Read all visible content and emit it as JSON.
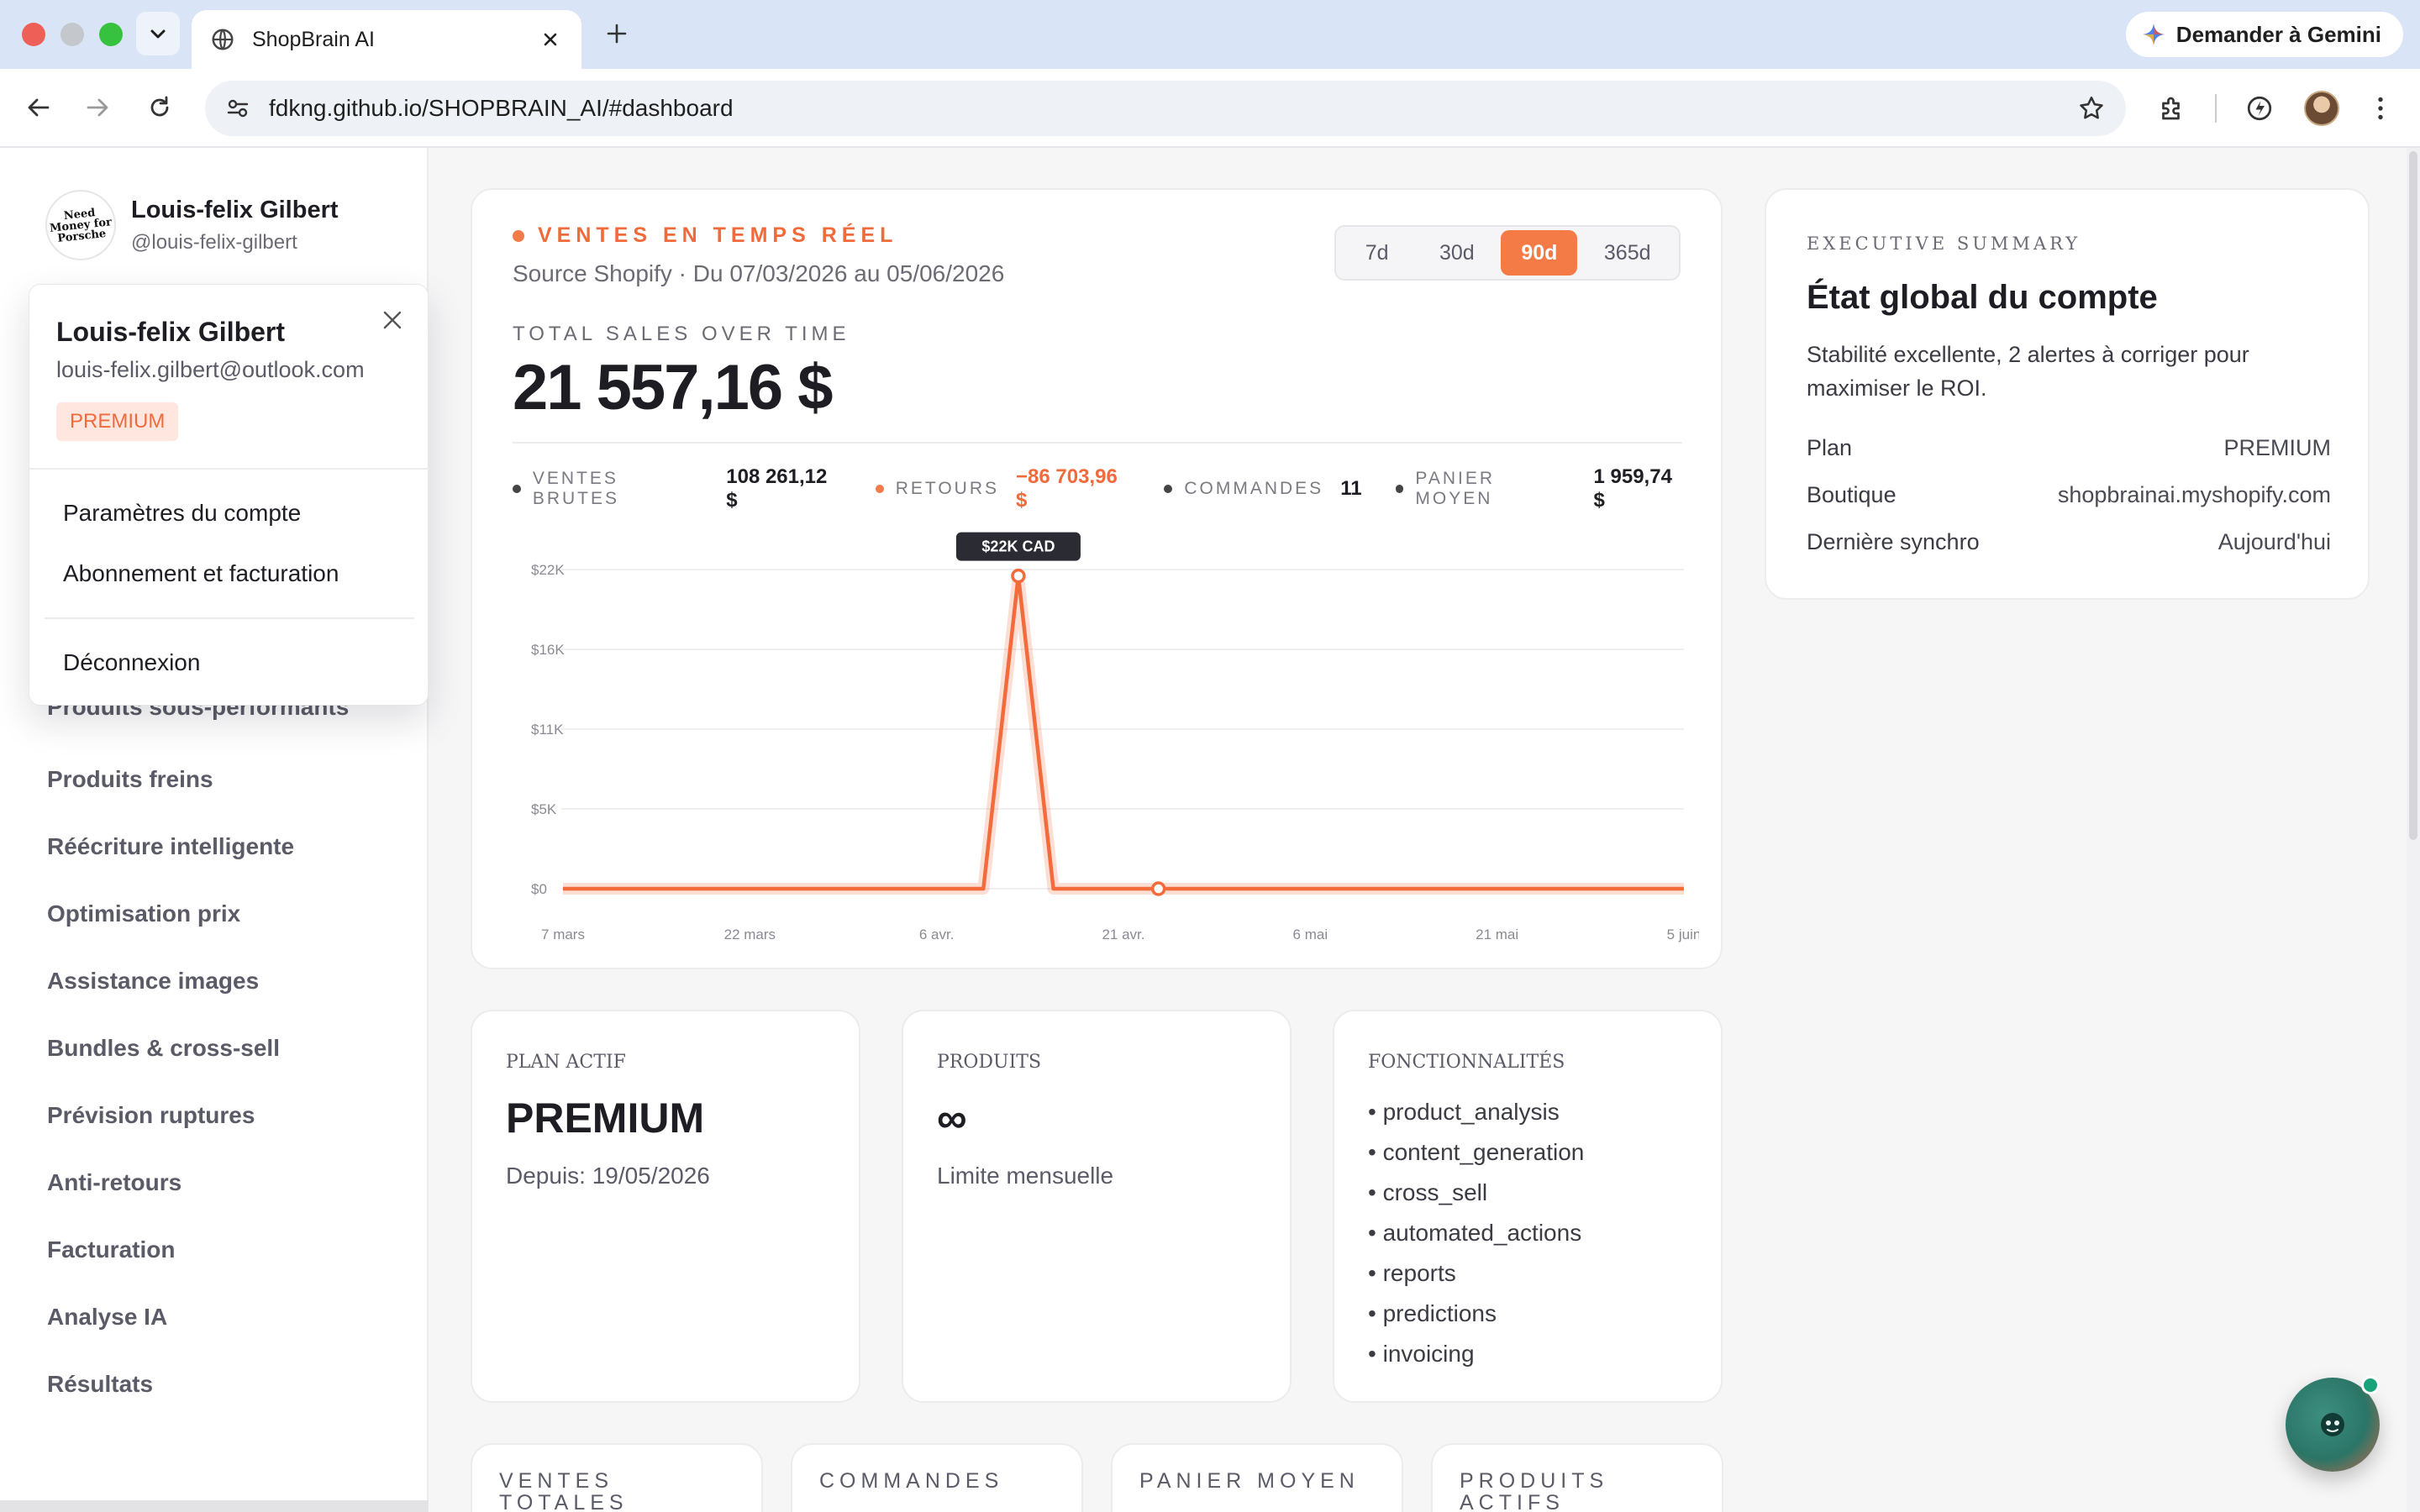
{
  "browser": {
    "tab_title": "ShopBrain AI",
    "url": "fdkng.github.io/SHOPBRAIN_AI/#dashboard",
    "gemini_label": "Demander à Gemini"
  },
  "profile": {
    "name": "Louis-felix Gilbert",
    "handle": "@louis-felix-gilbert",
    "avatar_text": "Need Money for Porsche"
  },
  "popover": {
    "name": "Louis-felix Gilbert",
    "email": "louis-felix.gilbert@outlook.com",
    "badge": "PREMIUM",
    "items": [
      "Paramètres du compte",
      "Abonnement et facturation"
    ],
    "logout": "Déconnexion"
  },
  "sidebar": {
    "partial_item": "Produits sous-performants",
    "items": [
      "Produits freins",
      "Réécriture intelligente",
      "Optimisation prix",
      "Assistance images",
      "Bundles & cross-sell",
      "Prévision ruptures",
      "Anti-retours",
      "Facturation",
      "Analyse IA",
      "Résultats"
    ]
  },
  "sales": {
    "eyebrow": "VENTES EN TEMPS RÉEL",
    "source": "Source Shopify · Du 07/03/2026 au 05/06/2026",
    "ranges": [
      "7d",
      "30d",
      "90d",
      "365d"
    ],
    "active_range": "90d",
    "total_label": "TOTAL SALES OVER TIME",
    "total": "21 557,16 $",
    "stats": [
      {
        "label": "VENTES BRUTES",
        "value": "108 261,12 $"
      },
      {
        "label": "RETOURS",
        "value": "−86 703,96 $"
      },
      {
        "label": "COMMANDES",
        "value": "11"
      },
      {
        "label": "PANIER MOYEN",
        "value": "1 959,74 $"
      }
    ]
  },
  "chart_data": {
    "type": "line",
    "x": [
      "7 mars",
      "9 mars",
      "12 mars",
      "15 mars",
      "18 mars",
      "21 mars",
      "24 mars",
      "27 mars",
      "30 mars",
      "2 avr.",
      "5 avr.",
      "8 avr.",
      "10 avr.",
      "11 avr.",
      "13 avr.",
      "16 avr.",
      "19 avr.",
      "21 avr.",
      "24 avr.",
      "27 avr.",
      "30 avr.",
      "3 mai",
      "6 mai",
      "9 mai",
      "12 mai",
      "15 mai",
      "18 mai",
      "21 mai",
      "24 mai",
      "27 mai",
      "30 mai",
      "2 juin",
      "5 juin"
    ],
    "series": [
      {
        "values": [
          0,
          0,
          0,
          0,
          0,
          0,
          0,
          0,
          0,
          0,
          0,
          0,
          0,
          21557.16,
          0,
          0,
          0,
          0,
          0,
          0,
          0,
          0,
          0,
          0,
          0,
          0,
          0,
          0,
          0,
          0,
          0,
          0,
          0
        ]
      }
    ],
    "x_tick_labels": [
      "7 mars",
      "22 mars",
      "6 avr.",
      "21 avr.",
      "6 mai",
      "21 mai",
      "5 juin"
    ],
    "y_tick_labels": [
      "$0",
      "$5K",
      "$11K",
      "$16K",
      "$22K"
    ],
    "ylim": [
      0,
      22000
    ],
    "grid": true,
    "tooltip": "$22K CAD",
    "markers": [
      {
        "x": "11 avr.",
        "y": 21557.16
      },
      {
        "x": "21 avr.",
        "y": 0
      }
    ],
    "color": "#f36b3b"
  },
  "summary": {
    "eyebrow": "EXECUTIVE SUMMARY",
    "title": "État global du compte",
    "description": "Stabilité excellente, 2 alertes à corriger pour maximiser le ROI.",
    "rows": [
      {
        "label": "Plan",
        "value": "PREMIUM"
      },
      {
        "label": "Boutique",
        "value": "shopbrainai.myshopify.com"
      },
      {
        "label": "Dernière synchro",
        "value": "Aujourd'hui"
      }
    ]
  },
  "plan_card": {
    "eyebrow": "PLAN ACTIF",
    "value": "PREMIUM",
    "sub": "Depuis: 19/05/2026"
  },
  "products_card": {
    "eyebrow": "PRODUITS",
    "value": "∞",
    "sub": "Limite mensuelle"
  },
  "features_card": {
    "eyebrow": "FONCTIONNALITÉS",
    "items": [
      "product_analysis",
      "content_generation",
      "cross_sell",
      "automated_actions",
      "reports",
      "predictions",
      "invoicing"
    ]
  },
  "kpis": [
    "VENTES TOTALES",
    "COMMANDES",
    "PANIER MOYEN",
    "PRODUITS ACTIFS"
  ],
  "colors": {
    "accent": "#f47a46",
    "accent_soft": "#ffe6de"
  }
}
